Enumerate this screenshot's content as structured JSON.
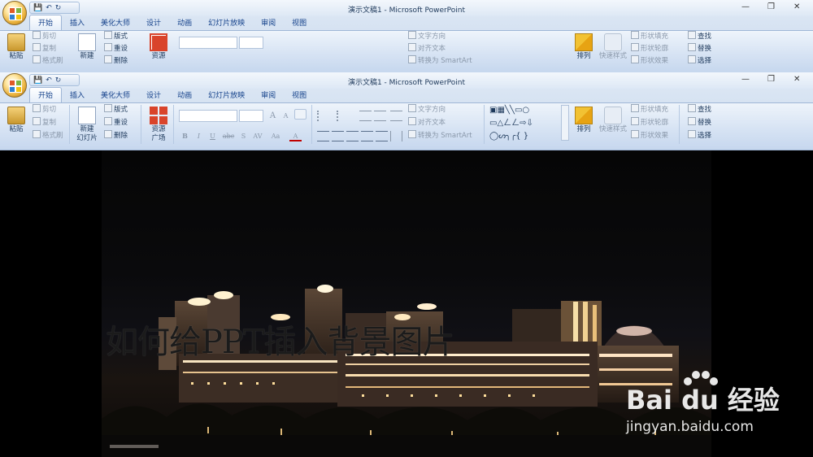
{
  "window": {
    "title": "演示文稿1 - Microsoft PowerPoint",
    "minimize": "—",
    "restore": "❐",
    "close": "✕"
  },
  "qat": {
    "save": "💾",
    "undo": "↶",
    "redo": "↻"
  },
  "tabs": [
    {
      "label": "开始",
      "active": true
    },
    {
      "label": "插入"
    },
    {
      "label": "美化大师"
    },
    {
      "label": "设计"
    },
    {
      "label": "动画"
    },
    {
      "label": "幻灯片放映"
    },
    {
      "label": "审阅"
    },
    {
      "label": "视图"
    }
  ],
  "ribbon": {
    "paste": "粘贴",
    "cut": "剪切",
    "copy": "复制",
    "format_painter": "格式刷",
    "new_slide_line1": "新建",
    "new_slide_line2": "幻灯片",
    "layout": "版式",
    "reset": "重设",
    "delete": "删除",
    "resource_line1": "资源",
    "resource_line2": "广场",
    "font_bold": "B",
    "font_italic": "I",
    "font_underline": "U",
    "font_strike": "abc",
    "font_shadow": "S",
    "font_spacing": "AV",
    "font_case": "Aa",
    "font_color": "A",
    "font_grow": "A",
    "font_shrink": "A",
    "text_direction": "文字方向",
    "align_text": "对齐文本",
    "smartart": "转换为 SmartArt",
    "arrange": "排列",
    "quick_styles": "快速样式",
    "shape_fill": "形状填充",
    "shape_outline": "形状轮廓",
    "shape_effects": "形状效果",
    "find": "查找",
    "replace": "替换",
    "select": "选择",
    "shapes_row1": "▣▦╲╲▭○",
    "shapes_row2": "▭△ㄥㄥ⇨⇩",
    "shapes_row3": "◯ᔕ╮╭{ }"
  },
  "slide": {
    "title": "如何给PPT插入背景图片"
  },
  "watermark": {
    "brand": "Bai du 经验",
    "url": "jingyan.baidu.com"
  },
  "colors": {
    "resource_icon": "#d9442b",
    "ribbon_text": "#1e395b",
    "tab_text": "#15428b"
  }
}
